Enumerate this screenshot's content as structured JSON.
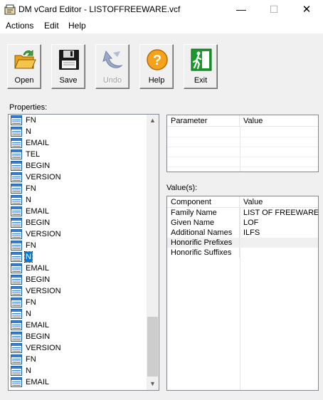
{
  "window": {
    "title": "DM vCard Editor - LISTOFFREEWARE.vcf",
    "minimize_glyph": "—",
    "maximize_glyph": "☐",
    "close_glyph": "✕"
  },
  "menu": {
    "items": [
      {
        "label": "Actions"
      },
      {
        "label": "Edit"
      },
      {
        "label": "Help"
      }
    ]
  },
  "toolbar": {
    "buttons": [
      {
        "label": "Open",
        "icon": "open-folder-icon",
        "enabled": true
      },
      {
        "label": "Save",
        "icon": "floppy-disk-icon",
        "enabled": true
      },
      {
        "label": "Undo",
        "icon": "undo-arrow-icon",
        "enabled": false
      },
      {
        "label": "Help",
        "icon": "help-question-icon",
        "enabled": true
      },
      {
        "label": "Exit",
        "icon": "exit-door-icon",
        "enabled": true
      }
    ]
  },
  "properties": {
    "label": "Properties:",
    "items": [
      "FN",
      "N",
      "EMAIL",
      "TEL",
      "BEGIN",
      "VERSION",
      "FN",
      "N",
      "EMAIL",
      "BEGIN",
      "VERSION",
      "FN",
      "N",
      "EMAIL",
      "BEGIN",
      "VERSION",
      "FN",
      "N",
      "EMAIL",
      "BEGIN",
      "VERSION",
      "FN",
      "N",
      "EMAIL"
    ],
    "selected_index": 12
  },
  "parameters": {
    "headers": {
      "parameter": "Parameter",
      "value": "Value"
    },
    "rows": []
  },
  "values": {
    "label": "Value(s):",
    "headers": {
      "component": "Component",
      "value": "Value"
    },
    "rows": [
      {
        "component": "Family Name",
        "value": "LIST OF FREEWARE"
      },
      {
        "component": "Given Name",
        "value": "LOF"
      },
      {
        "component": "Additional Names",
        "value": "ILFS"
      },
      {
        "component": "Honorific Prefixes",
        "value": ""
      },
      {
        "component": "Honorific Suffixes",
        "value": ""
      }
    ]
  },
  "colors": {
    "selection": "#0078d7",
    "window_bg": "#f0f0f0"
  }
}
